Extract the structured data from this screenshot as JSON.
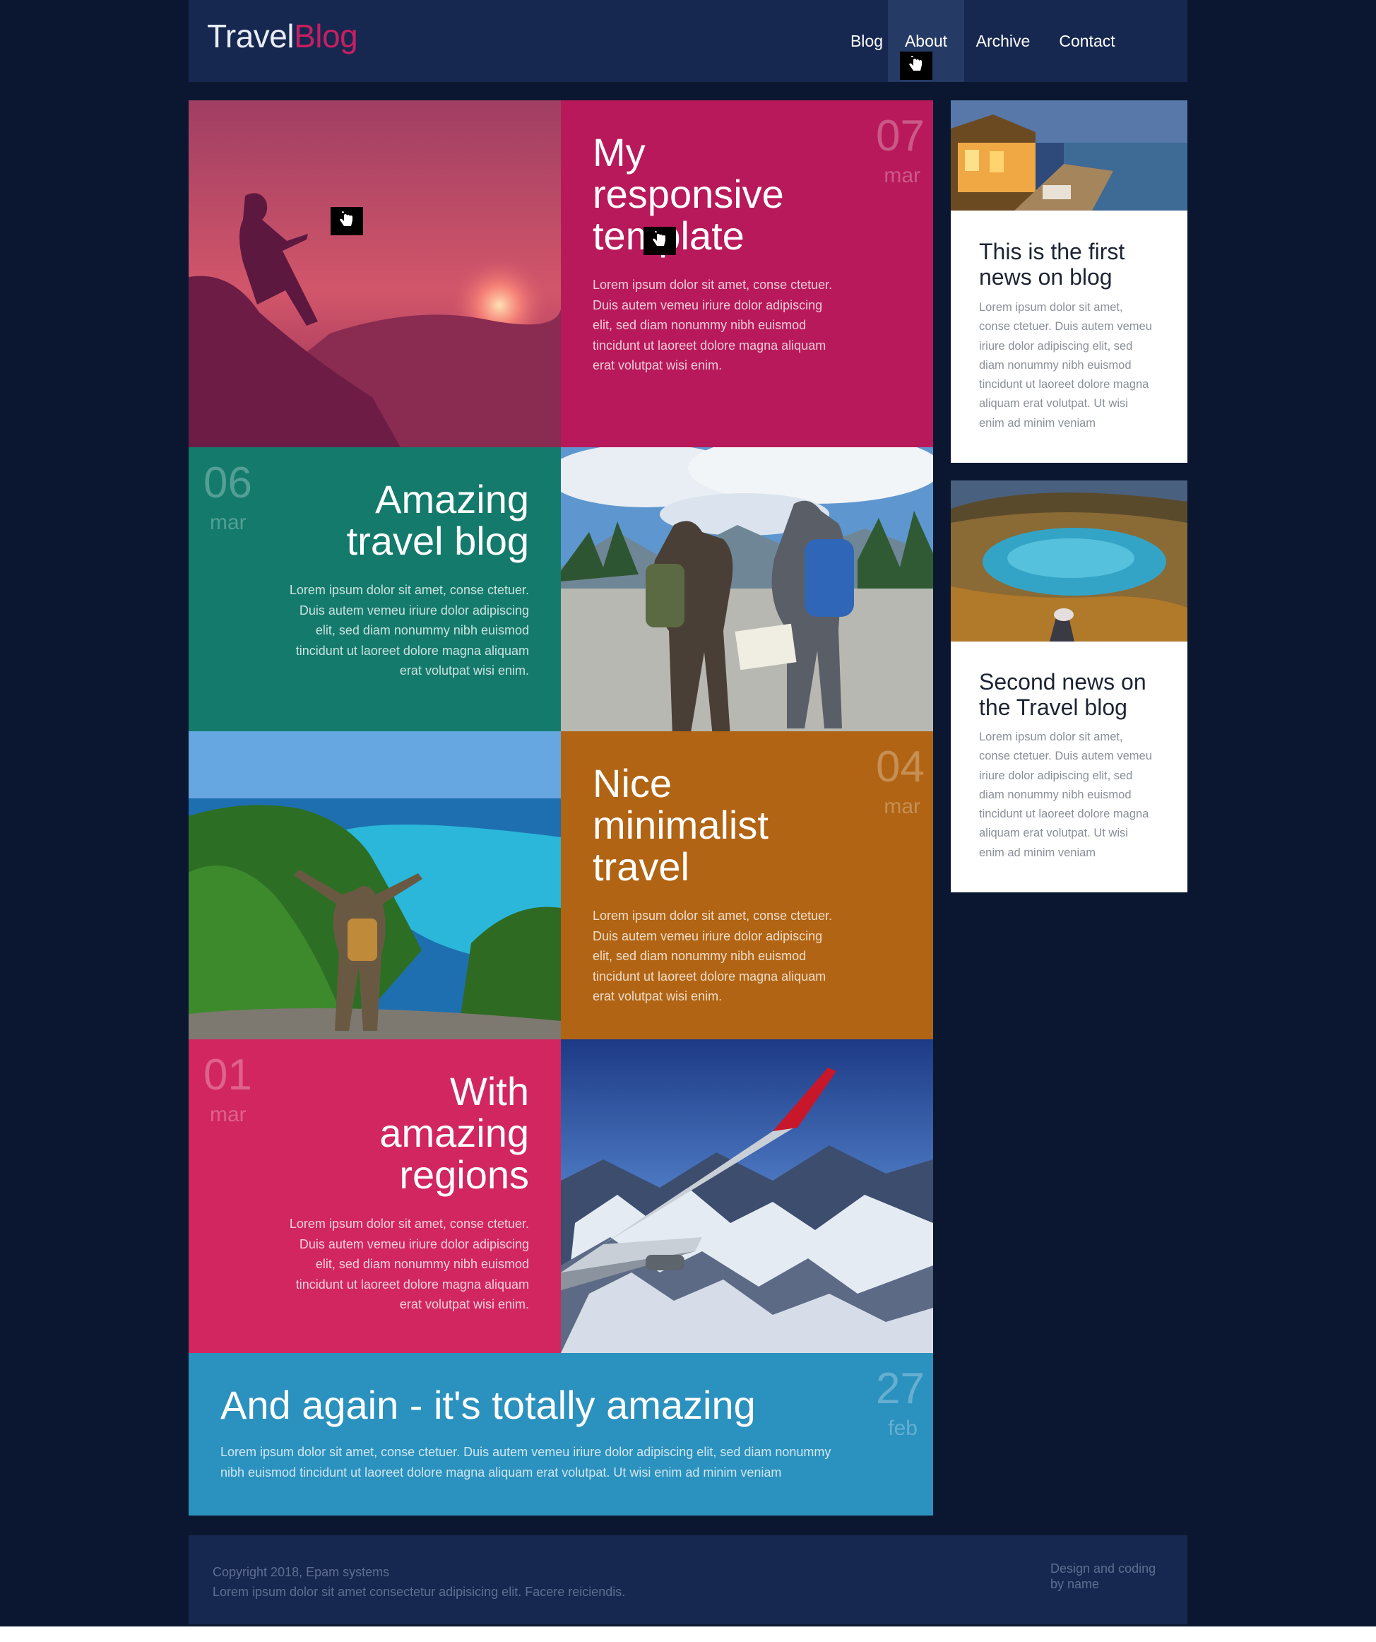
{
  "brand": {
    "part1": "Travel",
    "part2": "Blog"
  },
  "nav": {
    "items": [
      {
        "label": "Blog"
      },
      {
        "label": "About"
      },
      {
        "label": "Archive"
      },
      {
        "label": "Contact"
      }
    ]
  },
  "posts": [
    {
      "day": "07",
      "month": "mar",
      "title_lines": [
        "My",
        "responsive",
        "template"
      ],
      "text_lines": [
        "Lorem ipsum dolor sit amet, conse ctetuer.",
        "Duis autem vemeu iriure dolor adipiscing",
        "elit, sed diam nonummy nibh euismod",
        "tincidunt ut laoreet dolore magna aliquam",
        "erat volutpat wisi enim."
      ]
    },
    {
      "day": "06",
      "month": "mar",
      "title_lines": [
        "Amazing",
        "travel blog"
      ],
      "text_lines": [
        "Lorem ipsum dolor sit amet, conse ctetuer.",
        "Duis autem vemeu iriure dolor adipiscing",
        "elit, sed diam nonummy nibh euismod",
        "tincidunt ut laoreet dolore magna aliquam",
        "erat volutpat wisi enim."
      ]
    },
    {
      "day": "04",
      "month": "mar",
      "title_lines": [
        "Nice",
        "minimalist",
        "travel"
      ],
      "text_lines": [
        "Lorem ipsum dolor sit amet, conse ctetuer.",
        "Duis autem vemeu iriure dolor adipiscing",
        "elit, sed diam nonummy nibh euismod",
        "tincidunt ut laoreet dolore magna aliquam",
        "erat volutpat wisi enim."
      ]
    },
    {
      "day": "01",
      "month": "mar",
      "title_lines": [
        "With",
        "amazing",
        "regions"
      ],
      "text_lines": [
        "Lorem ipsum dolor sit amet, conse ctetuer.",
        "Duis autem vemeu iriure dolor adipiscing",
        "elit, sed diam nonummy nibh euismod",
        "tincidunt ut laoreet dolore magna aliquam",
        "erat volutpat wisi enim."
      ]
    },
    {
      "day": "27",
      "month": "feb",
      "title_lines": [
        "And again - it's totally amazing"
      ],
      "text_lines": [
        "Lorem ipsum dolor sit amet, conse ctetuer. Duis autem vemeu iriure dolor adipiscing elit, sed diam nonummy",
        "nibh euismod tincidunt ut laoreet dolore magna aliquam erat volutpat. Ut wisi enim ad minim veniam"
      ]
    }
  ],
  "news": [
    {
      "title_lines": [
        "This is the first",
        "news on blog"
      ],
      "text_lines": [
        "Lorem ipsum dolor sit amet,",
        "conse ctetuer. Duis autem vemeu",
        "iriure dolor adipiscing elit, sed",
        "diam nonummy nibh euismod",
        "tincidunt ut laoreet dolore magna",
        "aliquam erat volutpat. Ut wisi",
        "enim ad minim veniam"
      ]
    },
    {
      "title_lines": [
        "Second news on",
        "the Travel blog"
      ],
      "text_lines": [
        "Lorem ipsum dolor sit amet,",
        "conse ctetuer. Duis autem vemeu",
        "iriure dolor adipiscing elit, sed",
        "diam nonummy nibh euismod",
        "tincidunt ut laoreet dolore magna",
        "aliquam erat volutpat. Ut wisi",
        "enim ad minim veniam"
      ]
    }
  ],
  "footer": {
    "copyright": "Copyright 2018, Epam systems",
    "tagline": "Lorem ipsum dolor sit amet consectetur adipisicing elit. Facere reiciendis.",
    "credit_lines": [
      "Design and coding",
      "by name"
    ]
  },
  "colors": {
    "background": "#0b1730",
    "header": "#162750",
    "accent": "#c81f61",
    "post1": "#b8195a",
    "post2": "#137a6c",
    "post3": "#b16413",
    "post4": "#d12660",
    "post5": "#2b91be"
  },
  "icons": [
    "hand-pointer-cursor-icon"
  ]
}
